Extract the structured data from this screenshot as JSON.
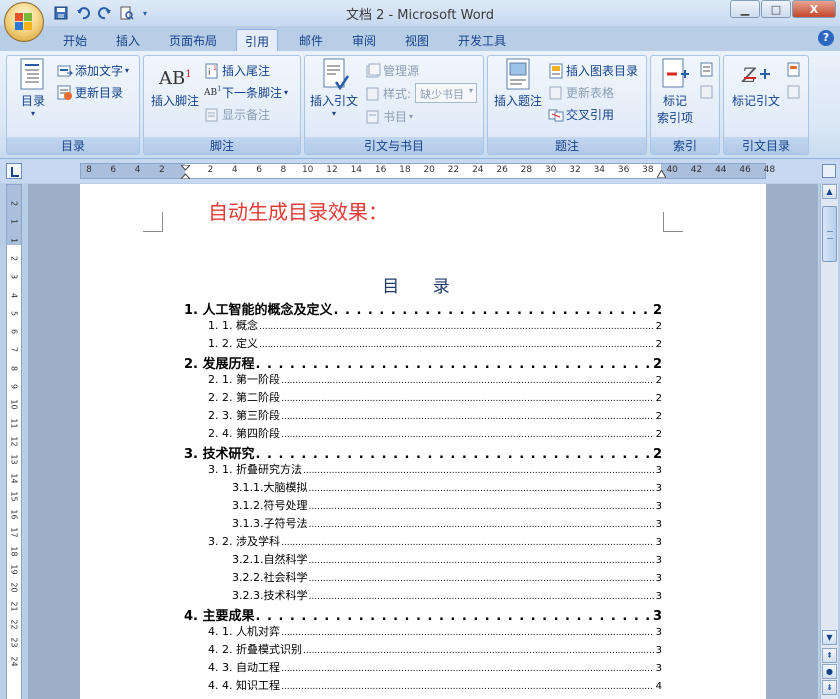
{
  "window": {
    "title": "文档 2 - Microsoft Word",
    "minimize": "▁",
    "maximize": "□",
    "close": "X"
  },
  "qat": {
    "save_icon": "save-icon",
    "undo_icon": "undo-icon",
    "redo_icon": "redo-icon",
    "preview_icon": "print-preview-icon"
  },
  "tabs": [
    "开始",
    "插入",
    "页面布局",
    "引用",
    "邮件",
    "审阅",
    "视图",
    "开发工具"
  ],
  "active_tab": "引用",
  "help": "?",
  "ribbon": {
    "toc_group": {
      "label": "目录",
      "toc_button": "目录",
      "add_text": "添加文字",
      "update_toc": "更新目录"
    },
    "footnote_group": {
      "label": "脚注",
      "insert_footnote": "插入脚注",
      "insert_endnote": "插入尾注",
      "next_footnote": "下一条脚注",
      "show_notes": "显示备注"
    },
    "citations_group": {
      "label": "引文与书目",
      "insert_citation": "插入引文",
      "manage_sources": "管理源",
      "style_label": "样式:",
      "style_value": "缺少书目",
      "bibliography": "书目"
    },
    "captions_group": {
      "label": "题注",
      "insert_caption": "插入题注",
      "insert_table_of_figures": "插入图表目录",
      "update_table": "更新表格",
      "cross_reference": "交叉引用"
    },
    "index_group": {
      "label": "索引",
      "mark_entry_line1": "标记",
      "mark_entry_line2": "索引项"
    },
    "toa_group": {
      "label": "引文目录",
      "mark_citation": "标记引文"
    }
  },
  "ruler": {
    "numbers": [
      "8",
      "6",
      "4",
      "2",
      "2",
      "4",
      "6",
      "8",
      "10",
      "12",
      "14",
      "16",
      "18",
      "20",
      "22",
      "24",
      "26",
      "28",
      "30",
      "32",
      "34",
      "36",
      "38",
      "40",
      "42",
      "44",
      "46",
      "48"
    ],
    "vertical_numbers": [
      "2",
      "1",
      "1",
      "2",
      "3",
      "4",
      "5",
      "6",
      "7",
      "8",
      "9",
      "10",
      "11",
      "12",
      "13",
      "14",
      "15",
      "16",
      "17",
      "18",
      "19",
      "20",
      "21",
      "22",
      "23",
      "24"
    ]
  },
  "document": {
    "heading": "自动生成目录效果：",
    "toc_title": "目 录",
    "entries": [
      {
        "level": 1,
        "text": "1. 人工智能的概念及定义",
        "page": "2"
      },
      {
        "level": 2,
        "text": "1. 1. 概念",
        "page": "2"
      },
      {
        "level": 2,
        "text": "1. 2. 定义",
        "page": "2"
      },
      {
        "level": 1,
        "text": "2. 发展历程",
        "page": "2"
      },
      {
        "level": 2,
        "text": "2. 1. 第一阶段",
        "page": "2"
      },
      {
        "level": 2,
        "text": "2. 2. 第二阶段",
        "page": "2"
      },
      {
        "level": 2,
        "text": "2. 3. 第三阶段",
        "page": "2"
      },
      {
        "level": 2,
        "text": "2. 4. 第四阶段",
        "page": "2"
      },
      {
        "level": 1,
        "text": "3. 技术研究",
        "page": "2"
      },
      {
        "level": 2,
        "text": "3. 1. 折叠研究方法",
        "page": "3"
      },
      {
        "level": 3,
        "text": "3.1.1.大脑模拟",
        "page": "3"
      },
      {
        "level": 3,
        "text": "3.1.2.符号处理",
        "page": "3"
      },
      {
        "level": 3,
        "text": "3.1.3.子符号法",
        "page": "3"
      },
      {
        "level": 2,
        "text": "3. 2. 涉及学科",
        "page": "3"
      },
      {
        "level": 3,
        "text": "3.2.1.自然科学",
        "page": "3"
      },
      {
        "level": 3,
        "text": "3.2.2.社会科学",
        "page": "3"
      },
      {
        "level": 3,
        "text": "3.2.3.技术科学",
        "page": "3"
      },
      {
        "level": 1,
        "text": "4. 主要成果",
        "page": "3"
      },
      {
        "level": 2,
        "text": "4. 1. 人机对弈",
        "page": "3"
      },
      {
        "level": 2,
        "text": "4. 2. 折叠模式识别",
        "page": "3"
      },
      {
        "level": 2,
        "text": "4. 3. 自动工程",
        "page": "3"
      },
      {
        "level": 2,
        "text": "4. 4. 知识工程",
        "page": "4"
      }
    ]
  },
  "colors": {
    "heading": "#e53a35",
    "toc_title": "#1f3b67",
    "ribbon_text": "#15428b"
  }
}
